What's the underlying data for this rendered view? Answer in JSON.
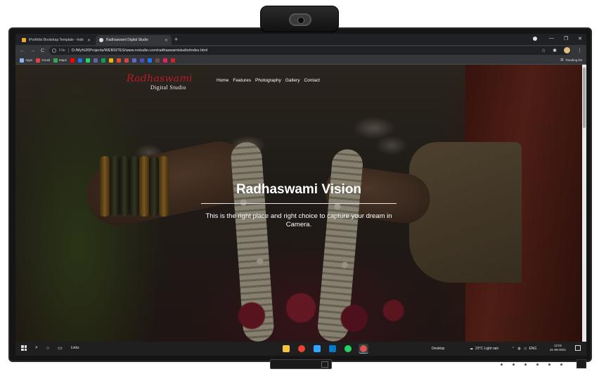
{
  "browser": {
    "tabs": [
      {
        "title": "iPortfolio Bootstrap Template - Inde",
        "favicon_color": "#f5a623",
        "active": false
      },
      {
        "title": "Radhaswami Digital Studio",
        "favicon_color": "#e0e0e0",
        "active": true
      }
    ],
    "new_tab": "+",
    "window_controls": {
      "minimize": "—",
      "maximize": "❐",
      "close": "✕"
    },
    "nav": {
      "back": "←",
      "forward": "→",
      "reload": "C"
    },
    "address": {
      "scheme": "File",
      "url": "D:/My%20Projects/WEBSITES/www.rvstudio.com/radhaswamistudio/index.html"
    },
    "bookmarks": [
      {
        "label": "Apps",
        "color": "#8ab4f8"
      },
      {
        "label": "Gmail",
        "color": "#ea4335"
      },
      {
        "label": "Maps",
        "color": "#34a853"
      },
      {
        "label": "",
        "color": "#ff0000"
      },
      {
        "label": "",
        "color": "#1a73e8"
      },
      {
        "label": "",
        "color": "#25d366"
      },
      {
        "label": "",
        "color": "#6264a7"
      },
      {
        "label": "",
        "color": "#0f9d58"
      },
      {
        "label": "",
        "color": "#f4b400"
      },
      {
        "label": "",
        "color": "#e34f26"
      },
      {
        "label": "",
        "color": "#db4437"
      },
      {
        "label": "",
        "color": "#5c6bc0"
      },
      {
        "label": "",
        "color": "#3f51b5"
      },
      {
        "label": "",
        "color": "#1877f2"
      },
      {
        "label": "",
        "color": "#6d4c41"
      },
      {
        "label": "",
        "color": "#e91e63"
      },
      {
        "label": "",
        "color": "#c62828"
      }
    ],
    "reading_list": "Reading list"
  },
  "site": {
    "logo_script": "Radhaswami",
    "logo_sub": "Digital Studio",
    "nav": [
      "Home",
      "Features",
      "Photography",
      "Gallery",
      "Contact"
    ],
    "hero_title": "Radhaswami Vision",
    "hero_text": "This is the right place and right choice to capture your dream in Camera."
  },
  "taskbar": {
    "links_label": "Links",
    "apps": [
      {
        "name": "file-explorer-icon",
        "color": "#f4c542",
        "active": false
      },
      {
        "name": "chrome-icon",
        "color": "#ea4335",
        "active": false
      },
      {
        "name": "photoshop-icon",
        "color": "#31a8ff",
        "active": false
      },
      {
        "name": "vscode-icon",
        "color": "#007acc",
        "active": false
      },
      {
        "name": "whatsapp-icon",
        "color": "#25d366",
        "active": false
      },
      {
        "name": "chrome-profile-icon",
        "color": "#d9534f",
        "active": true
      }
    ],
    "desktop_label": "Desktop",
    "weather": "23°C  Light rain",
    "language": "ENG",
    "time": "12:01",
    "date": "31-08-2021"
  }
}
